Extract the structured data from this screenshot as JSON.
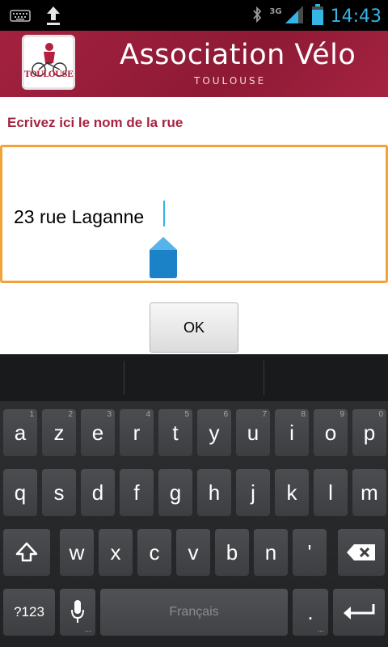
{
  "status_bar": {
    "time": "14:43",
    "network": "3G",
    "icons": [
      "keyboard-icon",
      "upload-icon",
      "bluetooth-icon",
      "signal-icon",
      "battery-icon"
    ]
  },
  "header": {
    "title": "Association Vélo",
    "subtitle": "TOULOUSE",
    "logo_text": "TOULOUSE",
    "colors": {
      "brand": "#a3213f"
    }
  },
  "form": {
    "prompt": "Ecrivez ici le nom de la rue",
    "street_value": "23 rue Laganne",
    "ok_label": "OK",
    "colors": {
      "field_border": "#f3a237",
      "cursor": "#33b5e5"
    }
  },
  "keyboard": {
    "row1": [
      {
        "label": "a",
        "num": "1"
      },
      {
        "label": "z",
        "num": "2"
      },
      {
        "label": "e",
        "num": "3"
      },
      {
        "label": "r",
        "num": "4"
      },
      {
        "label": "t",
        "num": "5"
      },
      {
        "label": "y",
        "num": "6"
      },
      {
        "label": "u",
        "num": "7"
      },
      {
        "label": "i",
        "num": "8"
      },
      {
        "label": "o",
        "num": "9"
      },
      {
        "label": "p",
        "num": "0"
      }
    ],
    "row2": [
      "q",
      "s",
      "d",
      "f",
      "g",
      "h",
      "j",
      "k",
      "l",
      "m"
    ],
    "row3": [
      "w",
      "x",
      "c",
      "v",
      "b",
      "n",
      "'"
    ],
    "symbols_label": "?123",
    "space_label": "Français",
    "period_label": ".",
    "ellipsis": "..."
  }
}
